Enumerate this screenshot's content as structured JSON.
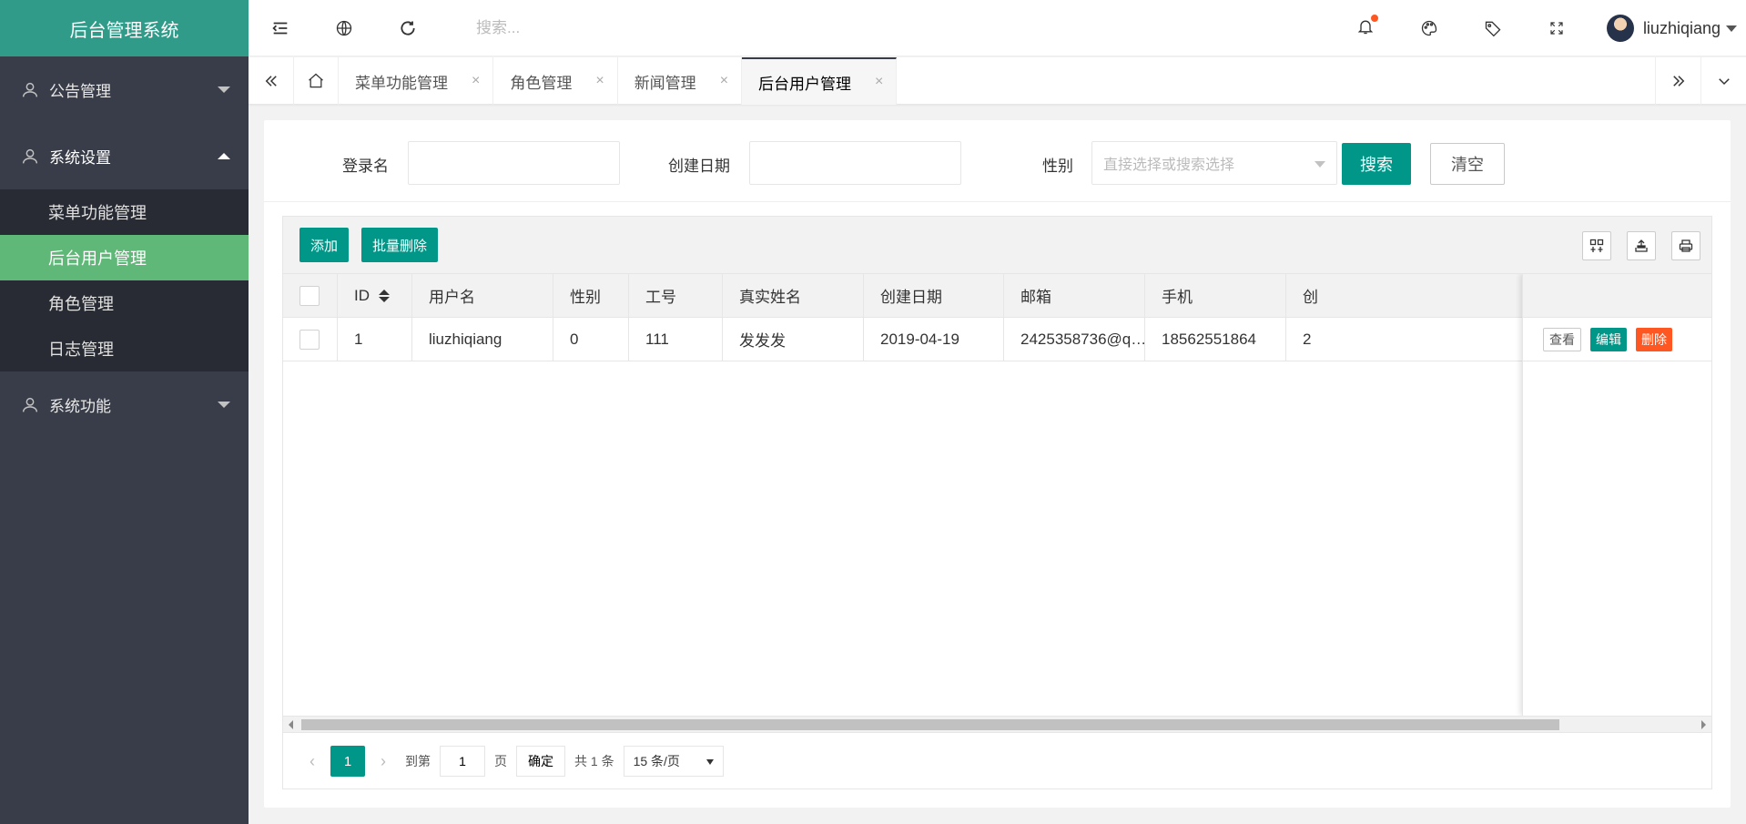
{
  "app": {
    "title": "后台管理系统"
  },
  "sidebar": {
    "groups": [
      {
        "label": "公告管理",
        "open": false
      },
      {
        "label": "系统设置",
        "open": true,
        "items": [
          "菜单功能管理",
          "后台用户管理",
          "角色管理",
          "日志管理"
        ],
        "active": "后台用户管理"
      },
      {
        "label": "系统功能",
        "open": false
      }
    ]
  },
  "header": {
    "search_placeholder": "搜索...",
    "username": "liuzhiqiang",
    "notification_dot_color": "#ff5722"
  },
  "tabs": {
    "items": [
      {
        "label": "菜单功能管理"
      },
      {
        "label": "角色管理"
      },
      {
        "label": "新闻管理"
      },
      {
        "label": "后台用户管理",
        "active": true
      }
    ],
    "close_glyph": "×"
  },
  "search_form": {
    "login_label": "登录名",
    "login_value": "",
    "date_label": "创建日期",
    "date_value": "",
    "gender_label": "性别",
    "gender_placeholder": "直接选择或搜索选择",
    "search_button": "搜索",
    "clear_button": "清空"
  },
  "toolbar": {
    "add_button": "添加",
    "batch_delete_button": "批量删除"
  },
  "table": {
    "columns": [
      "ID",
      "用户名",
      "性别",
      "工号",
      "真实姓名",
      "创建日期",
      "邮箱",
      "手机",
      "创"
    ],
    "rows": [
      {
        "id": "1",
        "username": "liuzhiqiang",
        "gender": "0",
        "job_no": "111",
        "real_name": "发发发",
        "created": "2019-04-19",
        "email": "2425358736@q…",
        "phone": "18562551864",
        "extra": "2"
      }
    ],
    "row_actions": {
      "view": "查看",
      "edit": "编辑",
      "delete": "删除"
    }
  },
  "pagination": {
    "current_page": "1",
    "goto_label": "到第",
    "page_input": "1",
    "page_unit": "页",
    "confirm": "确定",
    "total_text": "共 1 条",
    "limit": "15 条/页"
  },
  "colors": {
    "accent": "#009688",
    "logo_bg": "#2f9b88",
    "sidebar_bg": "#393d49",
    "active_item": "#5fb878",
    "danger": "#ff5722"
  }
}
